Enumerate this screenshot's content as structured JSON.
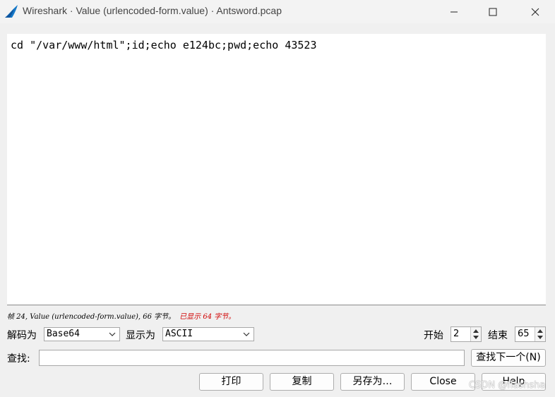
{
  "window": {
    "title": "Wireshark · Value (urlencoded-form.value) · Antsword.pcap"
  },
  "content": {
    "text": "cd \"/var/www/html\";id;echo e124bc;pwd;echo 43523"
  },
  "status": {
    "main": "帧 24, Value (urlencoded-form.value), 66 字节。",
    "shown": "已显示 64 字节。"
  },
  "decode": {
    "label": "解码为",
    "value": "Base64"
  },
  "display": {
    "label": "显示为",
    "value": "ASCII"
  },
  "start": {
    "label": "开始",
    "value": "2"
  },
  "end": {
    "label": "结束",
    "value": "65"
  },
  "find": {
    "label": "查找:",
    "value": "",
    "next_label": "查找下一个(N)"
  },
  "buttons": {
    "print": "打印",
    "copy": "复制",
    "save_as": "另存为…",
    "close": "Close",
    "help": "Help"
  },
  "watermark": "CSDN @flashsha"
}
